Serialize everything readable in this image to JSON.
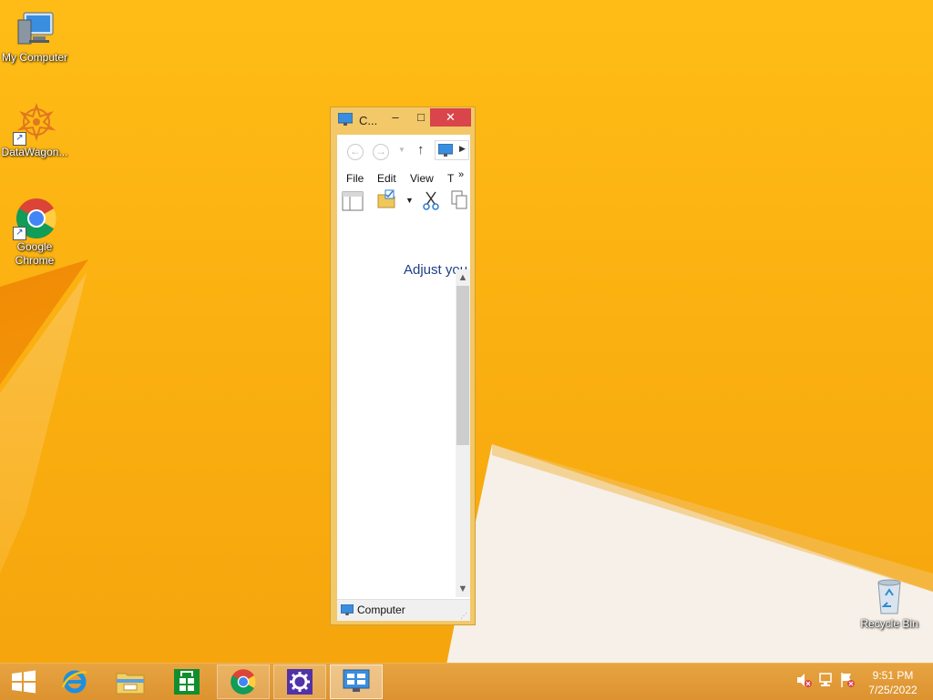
{
  "desktop": {
    "icons": [
      {
        "label": "My Computer"
      },
      {
        "label": "DataWagon..."
      },
      {
        "label": "Google Chrome"
      },
      {
        "label": "Recycle Bin"
      }
    ]
  },
  "window": {
    "title": "C...",
    "menu": {
      "file": "File",
      "edit": "Edit",
      "view": "View",
      "tools": "T",
      "more": "»"
    },
    "content_text": "Adjust you",
    "status_label": "Computer",
    "buttons": {
      "minimize": "–",
      "maximize": "□",
      "close": "✕"
    }
  },
  "taskbar": {
    "items": [
      {
        "icon": "windows-start-icon"
      },
      {
        "icon": "internet-explorer-icon"
      },
      {
        "icon": "file-explorer-icon"
      },
      {
        "icon": "store-icon"
      },
      {
        "icon": "chrome-icon"
      },
      {
        "icon": "settings-icon"
      },
      {
        "icon": "control-panel-icon"
      }
    ],
    "clock": {
      "time": "9:51 PM",
      "date": "7/25/2022"
    }
  },
  "colors": {
    "accent": "#ffbc16",
    "close": "#d9454a",
    "link_text": "#1e3f86"
  }
}
